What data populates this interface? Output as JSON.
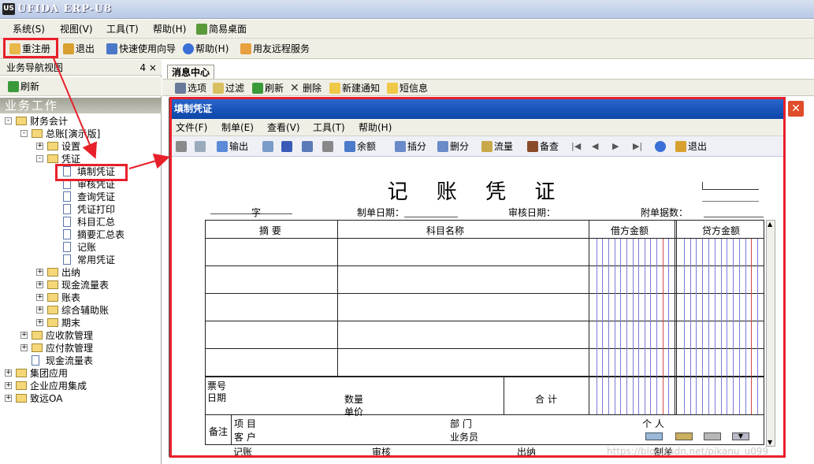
{
  "window": {
    "title": "UFIDA ERP-U8"
  },
  "menu": [
    "系统(S)",
    "视图(V)",
    "工具(T)",
    "帮助(H)",
    "简易桌面"
  ],
  "toolbar": [
    "重注册",
    "退出",
    "快速使用向导",
    "帮助(H)",
    "用友远程服务"
  ],
  "nav": {
    "title": "业务导航视图",
    "pin": "4 ×",
    "refresh": "刷新",
    "section": "业务工作"
  },
  "tree": [
    {
      "label": "财务会计",
      "level": 0,
      "type": "folder",
      "exp": "-"
    },
    {
      "label": "总账[演示版]",
      "level": 1,
      "type": "folder",
      "exp": "-"
    },
    {
      "label": "设置",
      "level": 2,
      "type": "folder",
      "exp": "+"
    },
    {
      "label": "凭证",
      "level": 2,
      "type": "folder",
      "exp": "-"
    },
    {
      "label": "填制凭证",
      "level": 3,
      "type": "doc"
    },
    {
      "label": "审核凭证",
      "level": 3,
      "type": "doc"
    },
    {
      "label": "查询凭证",
      "level": 3,
      "type": "doc"
    },
    {
      "label": "凭证打印",
      "level": 3,
      "type": "doc"
    },
    {
      "label": "科目汇总",
      "level": 3,
      "type": "doc"
    },
    {
      "label": "摘要汇总表",
      "level": 3,
      "type": "doc"
    },
    {
      "label": "记账",
      "level": 3,
      "type": "doc"
    },
    {
      "label": "常用凭证",
      "level": 3,
      "type": "doc"
    },
    {
      "label": "出纳",
      "level": 2,
      "type": "folder",
      "exp": "+"
    },
    {
      "label": "现金流量表",
      "level": 2,
      "type": "folder",
      "exp": "+"
    },
    {
      "label": "账表",
      "level": 2,
      "type": "folder",
      "exp": "+"
    },
    {
      "label": "综合辅助账",
      "level": 2,
      "type": "folder",
      "exp": "+"
    },
    {
      "label": "期末",
      "level": 2,
      "type": "folder",
      "exp": "+"
    },
    {
      "label": "应收款管理",
      "level": 1,
      "type": "folder",
      "exp": "+"
    },
    {
      "label": "应付款管理",
      "level": 1,
      "type": "folder",
      "exp": "+"
    },
    {
      "label": "现金流量表",
      "level": 1,
      "type": "doc"
    },
    {
      "label": "集团应用",
      "level": 0,
      "type": "folder",
      "exp": "+"
    },
    {
      "label": "企业应用集成",
      "level": 0,
      "type": "folder",
      "exp": "+"
    },
    {
      "label": "致远OA",
      "level": 0,
      "type": "folder",
      "exp": "+"
    }
  ],
  "msgcenter": {
    "tab": "消息中心",
    "tools": [
      "选项",
      "过滤",
      "刷新",
      "删除",
      "新建通知",
      "短信息"
    ]
  },
  "voucher": {
    "win_title": "填制凭证",
    "menu": [
      "文件(F)",
      "制单(E)",
      "查看(V)",
      "工具(T)",
      "帮助(H)"
    ],
    "tools": [
      "输出",
      "余额",
      "插分",
      "删分",
      "流量",
      "备查",
      "退出"
    ],
    "title": "记 账 凭 证",
    "zi": "字",
    "date_label": "制单日期：",
    "audit_date": "审核日期：",
    "attach": "附单据数：",
    "cols": [
      "摘 要",
      "科目名称",
      "借方金额",
      "贷方金额"
    ],
    "piao": "票号",
    "riqi": "日期",
    "shuliang": "数量",
    "danjia": "单价",
    "heji": "合 计",
    "beizhu": "备注",
    "xiangmu": "项 目",
    "kehu": "客 户",
    "bumen": "部 门",
    "yewuyuan": "业务员",
    "geren": "个 人",
    "footer": [
      "记账",
      "审核",
      "出纳",
      "制单"
    ]
  },
  "watermark": "https://blog.csdn.net/pikanu_u099"
}
